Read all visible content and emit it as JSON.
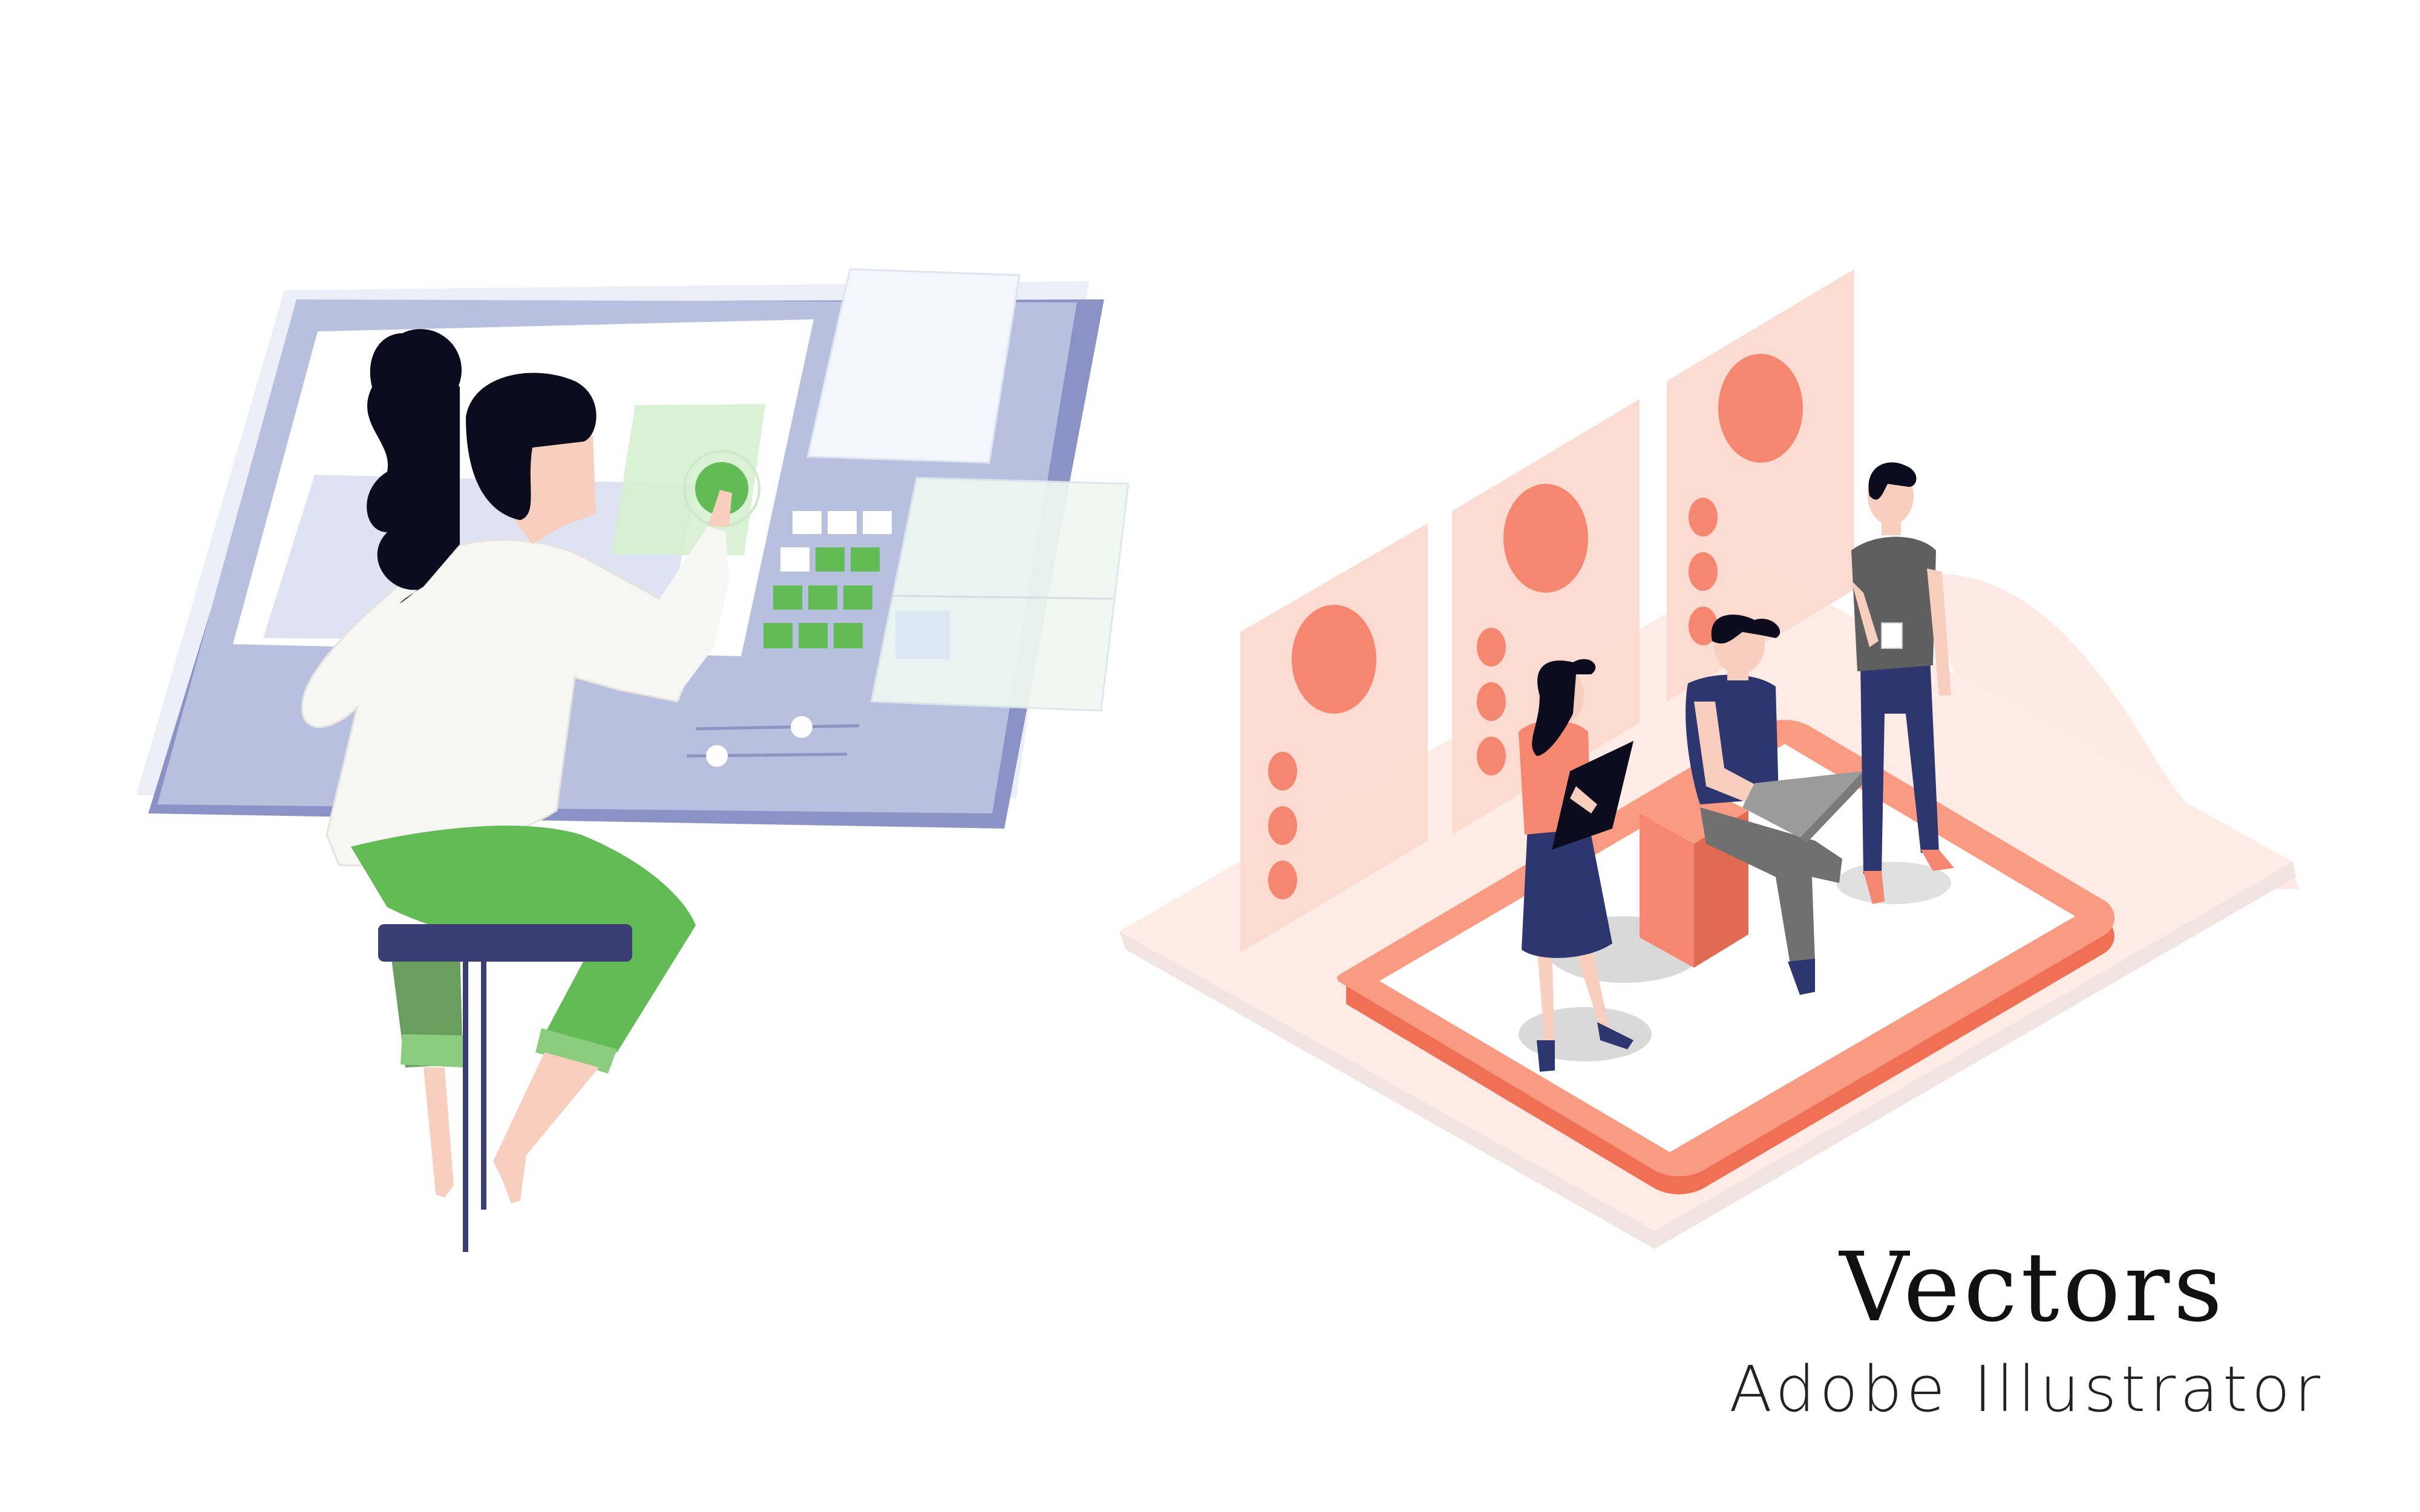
{
  "caption": {
    "title": "Vectors",
    "subtitle": "Adobe Illustrator"
  },
  "colors": {
    "panel_light": "#eceef8",
    "panel_main": "#b8c0e0",
    "panel_dark": "#8a92c6",
    "screen_white": "#ffffff",
    "green": "#62bb55",
    "green_soft": "#d6efd2",
    "hair": "#0c0c1e",
    "skin": "#f8cfbf",
    "shirt_white": "#f6f6f4",
    "stool": "#3a3e72",
    "salmon": "#f58670",
    "salmon_light": "#fde8e2",
    "salmon_panel": "#fcd9ce",
    "navy": "#2e3670",
    "gray_shirt": "#5f5f5f",
    "shadow": "#d9d9d9"
  },
  "scenes": {
    "left": {
      "name": "woman-at-control-panel-illustration",
      "icons": [
        "touchscreen-panel",
        "keypad-grid",
        "slider-controls",
        "floating-windows"
      ]
    },
    "right": {
      "name": "isometric-team-on-phone-illustration",
      "icons": [
        "phone-platform",
        "profile-cards",
        "laptop",
        "clipboard",
        "coffee-cup"
      ]
    }
  }
}
